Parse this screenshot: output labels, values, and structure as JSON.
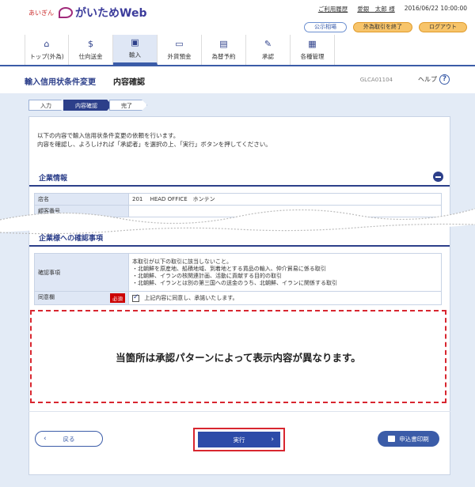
{
  "header": {
    "brand_small": "あいぎん",
    "brand_name": "がいためWeb",
    "user_menu_link": "ご利用履歴",
    "user_name": "愛銀　太郎 様",
    "timestamp": "2016/06/22 10:00:00",
    "public_rates_label": "公示相場",
    "end_forex_label": "外為取引を終了",
    "logout_label": "ログアウト"
  },
  "nav": {
    "items": [
      {
        "label": "トップ(外為)",
        "icon": "home-icon"
      },
      {
        "label": "仕向送金",
        "icon": "remittance-icon"
      },
      {
        "label": "輸入",
        "icon": "import-icon"
      },
      {
        "label": "外貨預金",
        "icon": "deposit-icon"
      },
      {
        "label": "為替予約",
        "icon": "forward-contract-icon"
      },
      {
        "label": "承認",
        "icon": "approval-icon"
      },
      {
        "label": "各種管理",
        "icon": "admin-icon"
      }
    ],
    "active_index": 2
  },
  "page": {
    "title": "輸入信用状条件変更",
    "subtitle": "内容確認",
    "screen_id": "GLCA01104",
    "help_label": "ヘルプ"
  },
  "steps": [
    "入力",
    "内容確認",
    "完了"
  ],
  "intro": {
    "line1": "以下の内容で輸入信用状条件変更の依頼を行います。",
    "line2": "内容を確認し、よろしければ「承認者」を選択の上、「実行」ボタンを押してください。"
  },
  "company_info": {
    "title": "企業情報",
    "rows": [
      {
        "label": "店名",
        "value": "201　 HEAD OFFICE　ホンテン"
      },
      {
        "label": "顧客番号",
        "value": ""
      }
    ]
  },
  "confirm_section": {
    "title": "企業様への確認事項",
    "label": "確認事項",
    "text_lines": [
      "本取引が以下の取引に該当しないこと。",
      "・北朝鮮を原産地、船積地域、到着地とする貨品の輸入、仲介貿易に係る取引",
      "・北朝鮮、イランの核関連計画、活動に貢献する目的の取引",
      "・北朝鮮、イランとは別の第三国への送金のうち、北朝鮮、イランに関係する取引"
    ],
    "agree_label": "同意欄",
    "required_label": "必須",
    "agree_text": "上記内容に同意し、承諾いたします。"
  },
  "note": "当箇所は承認パターンによって表示内容が異なります。",
  "buttons": {
    "back": "戻る",
    "execute": "実行",
    "print": "申込書印刷"
  }
}
